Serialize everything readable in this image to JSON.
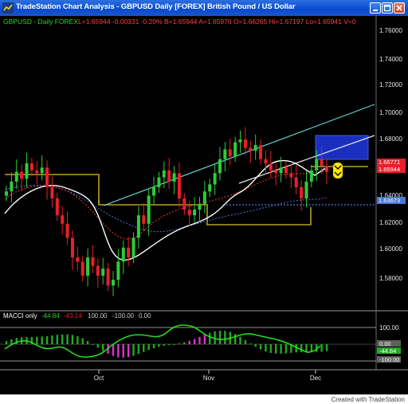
{
  "window": {
    "title": "TradeStation Chart Analysis - GBPUSD Daily [FOREX] British Pound / US Dollar"
  },
  "colors": {
    "background": "#000000",
    "up_candle": "#2ecc3a",
    "down_candle": "#e8202a",
    "title_bar": "#0a4ad0",
    "ma_white": "#ffffff",
    "ma_red_dotted": "#e03030",
    "ma_blue_dotted": "#4a78d8",
    "trendline": "#5fd0d0",
    "channel": "#b8a020",
    "highlight_box": "#1a2fc0",
    "macci_line": "#22dd22",
    "macci_hist_up": "#22aa22",
    "macci_hist_ob": "#dd33cc"
  },
  "header": {
    "symbol": "GBPUSD - Daily  FOREX",
    "values": "L=1.65944  -0.00331  -0.20%  B=1.65944  A=1.65976  O=1.66265  Hi=1.67197  Lo=1.65941  V=0"
  },
  "price_axis": {
    "ticks": [
      "1.76000",
      "1.74000",
      "1.72000",
      "1.70000",
      "1.68000",
      "1.64000",
      "1.62000",
      "1.60000",
      "1.58000"
    ],
    "badges": [
      {
        "text": "1.66771",
        "color": "#e8202a"
      },
      {
        "text": "1.65944",
        "color": "#e8202a"
      },
      {
        "text": "1.63673",
        "color": "#4a78d8"
      }
    ]
  },
  "indicator": {
    "label": "MACCI only",
    "values": [
      {
        "text": "-44.84",
        "color": "#22dd22"
      },
      {
        "text": "-43.14",
        "color": "#e8202a"
      },
      {
        "text": "100.00",
        "color": "#cccccc"
      },
      {
        "text": "-100.00",
        "color": "#cccccc"
      },
      {
        "text": "0.00",
        "color": "#cccccc"
      }
    ],
    "axis": [
      "100.00",
      "0.00",
      "-44.84",
      "-100.00"
    ]
  },
  "time_axis": [
    "Oct",
    "Nov",
    "Dec"
  ],
  "footer": "Created with TradeStation",
  "chart_data": {
    "type": "line",
    "title": "GBPUSD Daily",
    "series": [
      {
        "name": "L",
        "description": "candle closes (approx.)",
        "values": [
          1.645,
          1.652,
          1.659,
          1.654,
          1.665,
          1.66,
          1.658,
          1.662,
          1.648,
          1.64,
          1.628,
          1.622,
          1.612,
          1.598,
          1.595,
          1.585,
          1.598,
          1.592,
          1.585,
          1.59,
          1.578,
          1.582,
          1.595,
          1.605,
          1.598,
          1.612,
          1.628,
          1.622,
          1.642,
          1.648,
          1.655,
          1.66,
          1.652,
          1.658,
          1.64,
          1.632,
          1.628,
          1.632,
          1.636,
          1.645,
          1.65,
          1.658,
          1.668,
          1.675,
          1.67,
          1.68,
          1.682,
          1.676,
          1.674,
          1.678,
          1.668,
          1.665,
          1.66,
          1.658,
          1.662,
          1.658,
          1.655,
          1.648,
          1.64,
          1.652,
          1.66,
          1.668,
          1.663,
          1.659
        ]
      }
    ],
    "ylim": [
      1.56,
      1.77
    ],
    "x_labels": [
      "Oct",
      "Nov",
      "Dec"
    ]
  }
}
